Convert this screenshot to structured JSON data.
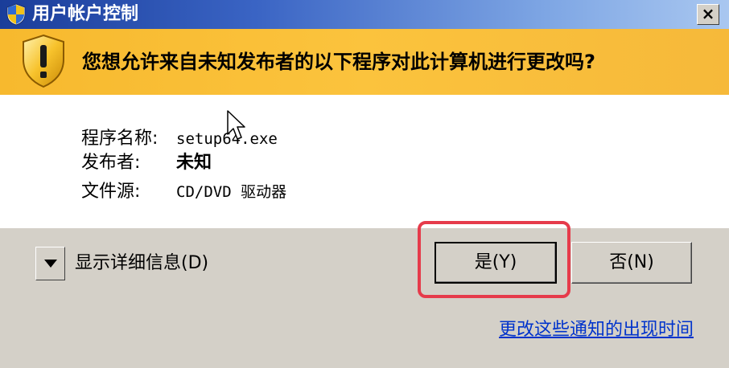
{
  "window": {
    "title": "用户帐户控制",
    "close_label": "×"
  },
  "banner": {
    "question": "您想允许来自未知发布者的以下程序对此计算机进行更改吗?"
  },
  "details": {
    "program_name_label": "程序名称:",
    "program_name_value": "setup64.exe",
    "publisher_label": "发布者:",
    "publisher_value": "未知",
    "file_source_label": "文件源:",
    "file_source_value": "CD/DVD 驱动器"
  },
  "footer": {
    "show_details_label": "显示详细信息(D)",
    "yes_label": "是(Y)",
    "no_label": "否(N)",
    "notification_link": "更改这些通知的出现时间"
  },
  "colors": {
    "title_bar": "#1a3d9a",
    "banner": "#fbc33d",
    "highlight": "#e63b4b",
    "link": "#0033cc"
  },
  "icons": {
    "title": "uac-shield-icon",
    "banner": "warning-shield-icon",
    "toggle": "chevron-down-icon",
    "cursor": "mouse-cursor-icon"
  }
}
